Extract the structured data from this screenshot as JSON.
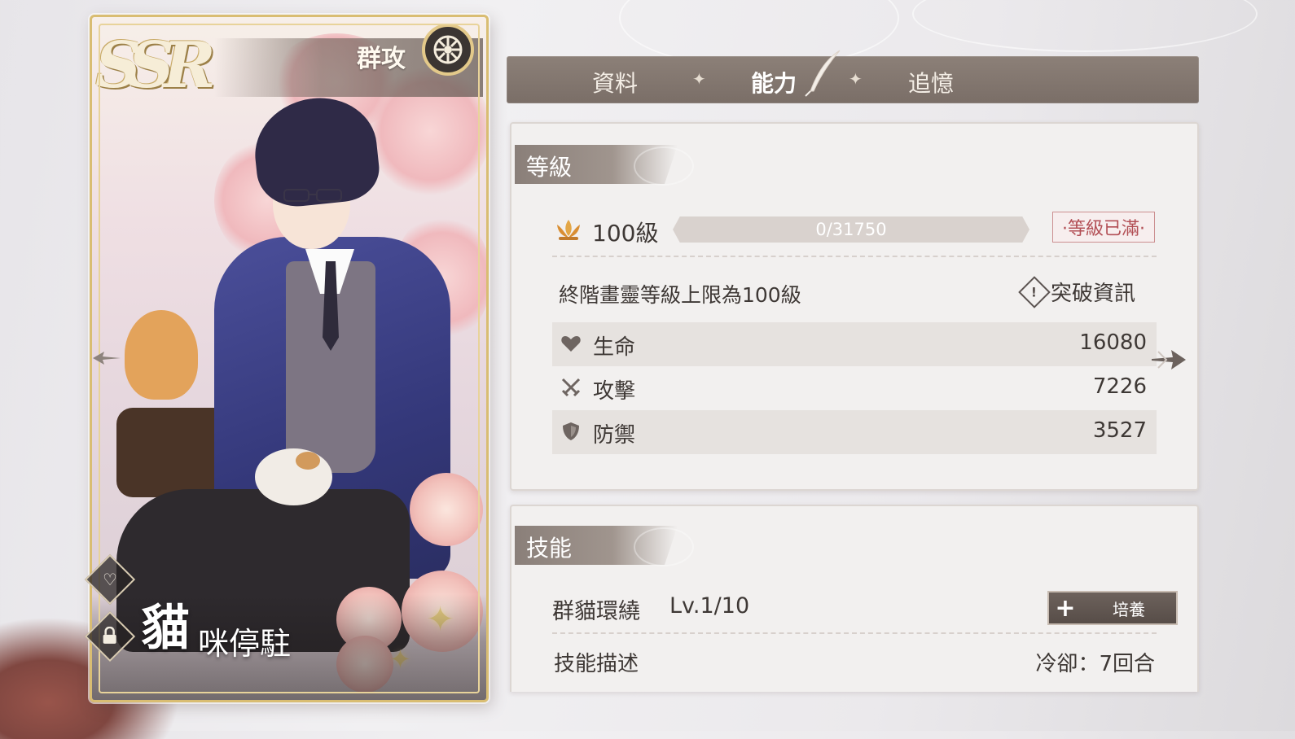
{
  "card": {
    "rarity": "SSR",
    "type_label": "群攻",
    "name_first": "貓",
    "name_rest": "咪停駐",
    "icons": {
      "type": "wheel-icon",
      "heart": "heart-icon",
      "lock": "lock-icon"
    }
  },
  "tabs": [
    {
      "label": "資料",
      "active": false
    },
    {
      "label": "能力",
      "active": true
    },
    {
      "label": "追憶",
      "active": false
    }
  ],
  "level_section": {
    "title": "等級",
    "level": "100級",
    "exp": "0/31750",
    "exp_progress": 0,
    "max_badge": "·等級已滿·",
    "limit_note": "終階畫靈等級上限為100級",
    "breakthrough_label": "突破資訊",
    "stats": [
      {
        "icon": "heart-icon",
        "label": "生命",
        "value": "16080"
      },
      {
        "icon": "crossed-swords-icon",
        "label": "攻擊",
        "value": "7226"
      },
      {
        "icon": "shield-icon",
        "label": "防禦",
        "value": "3527"
      }
    ]
  },
  "skill_section": {
    "title": "技能",
    "skill_name": "群貓環繞",
    "skill_level": "Lv.1/10",
    "train_label": "培養",
    "desc_label": "技能描述",
    "cooldown": "冷卻：7回合"
  },
  "colors": {
    "tab_bar": "#7a6e67",
    "panel_bg": "#f2f0ef",
    "max_badge": "#b24f55",
    "card_frame": "#d9bd72"
  }
}
